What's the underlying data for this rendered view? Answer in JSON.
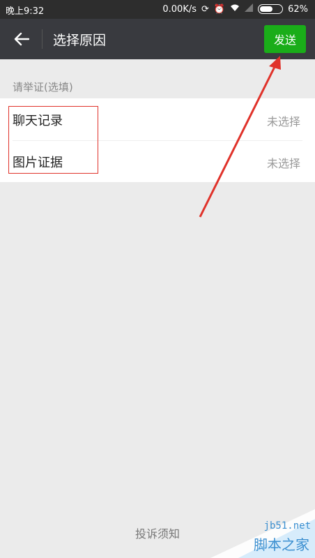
{
  "status_bar": {
    "time": "晚上9:32",
    "network_speed": "0.00K/s",
    "battery": "62%",
    "battery_level": 0.62
  },
  "toolbar": {
    "title": "选择原因",
    "send_label": "发送"
  },
  "evidence": {
    "section_label": "请举证(选填)",
    "items": [
      {
        "label": "聊天记录",
        "value": "未选择"
      },
      {
        "label": "图片证据",
        "value": "未选择"
      }
    ]
  },
  "footer": {
    "link": "投诉须知"
  },
  "watermark": {
    "url": "jb51.net",
    "text": "脚本之家"
  },
  "colors": {
    "accent": "#1aad19",
    "annotation": "#e0322a",
    "toolbar": "#393a3f"
  }
}
